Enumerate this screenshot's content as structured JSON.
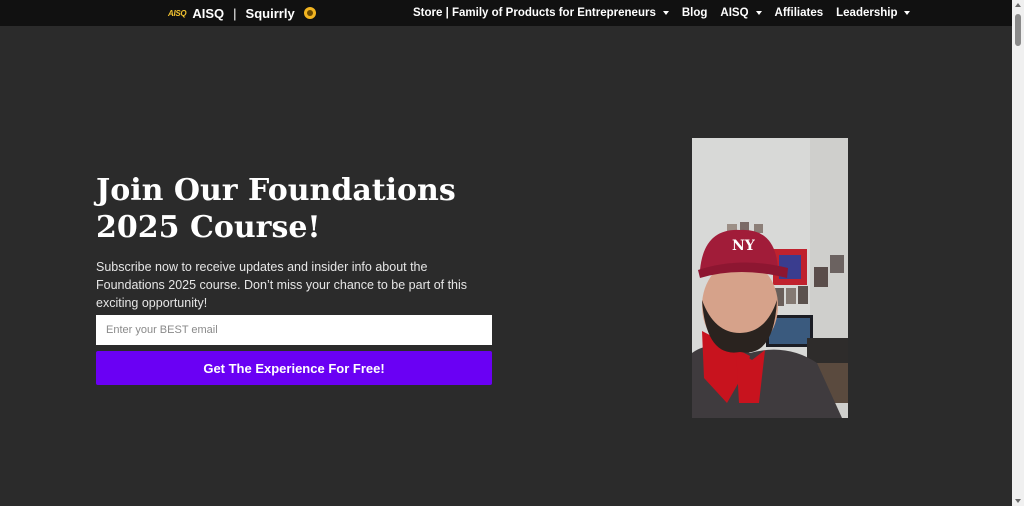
{
  "header": {
    "aisq_logo_text": "AISQ",
    "brand_aisq": "AISQ",
    "separator": "|",
    "brand_squirrly": "Squirrly",
    "nav": [
      {
        "label": "Store | Family of Products for Entrepreneurs",
        "dropdown": true
      },
      {
        "label": "Blog",
        "dropdown": false
      },
      {
        "label": "AISQ",
        "dropdown": true
      },
      {
        "label": "Affiliates",
        "dropdown": false
      },
      {
        "label": "Leadership",
        "dropdown": true
      }
    ]
  },
  "hero": {
    "title": "Join Our Foundations 2025 Course!",
    "subtitle": "Subscribe now to receive updates and insider info about the Foundations 2025 course. Don’t miss your chance to be part of this exciting opportunity!",
    "email_placeholder": "Enter your BEST email",
    "email_value": "",
    "cta_label": "Get The Experience For Free!"
  },
  "colors": {
    "page_bg": "#2b2b2b",
    "topbar_bg": "#111111",
    "cta_bg": "#6a00f4",
    "logo_yellow": "#f2b420"
  },
  "icons": [
    "aisq-logo-icon",
    "squirrly-logo-icon",
    "chevron-down-icon"
  ]
}
